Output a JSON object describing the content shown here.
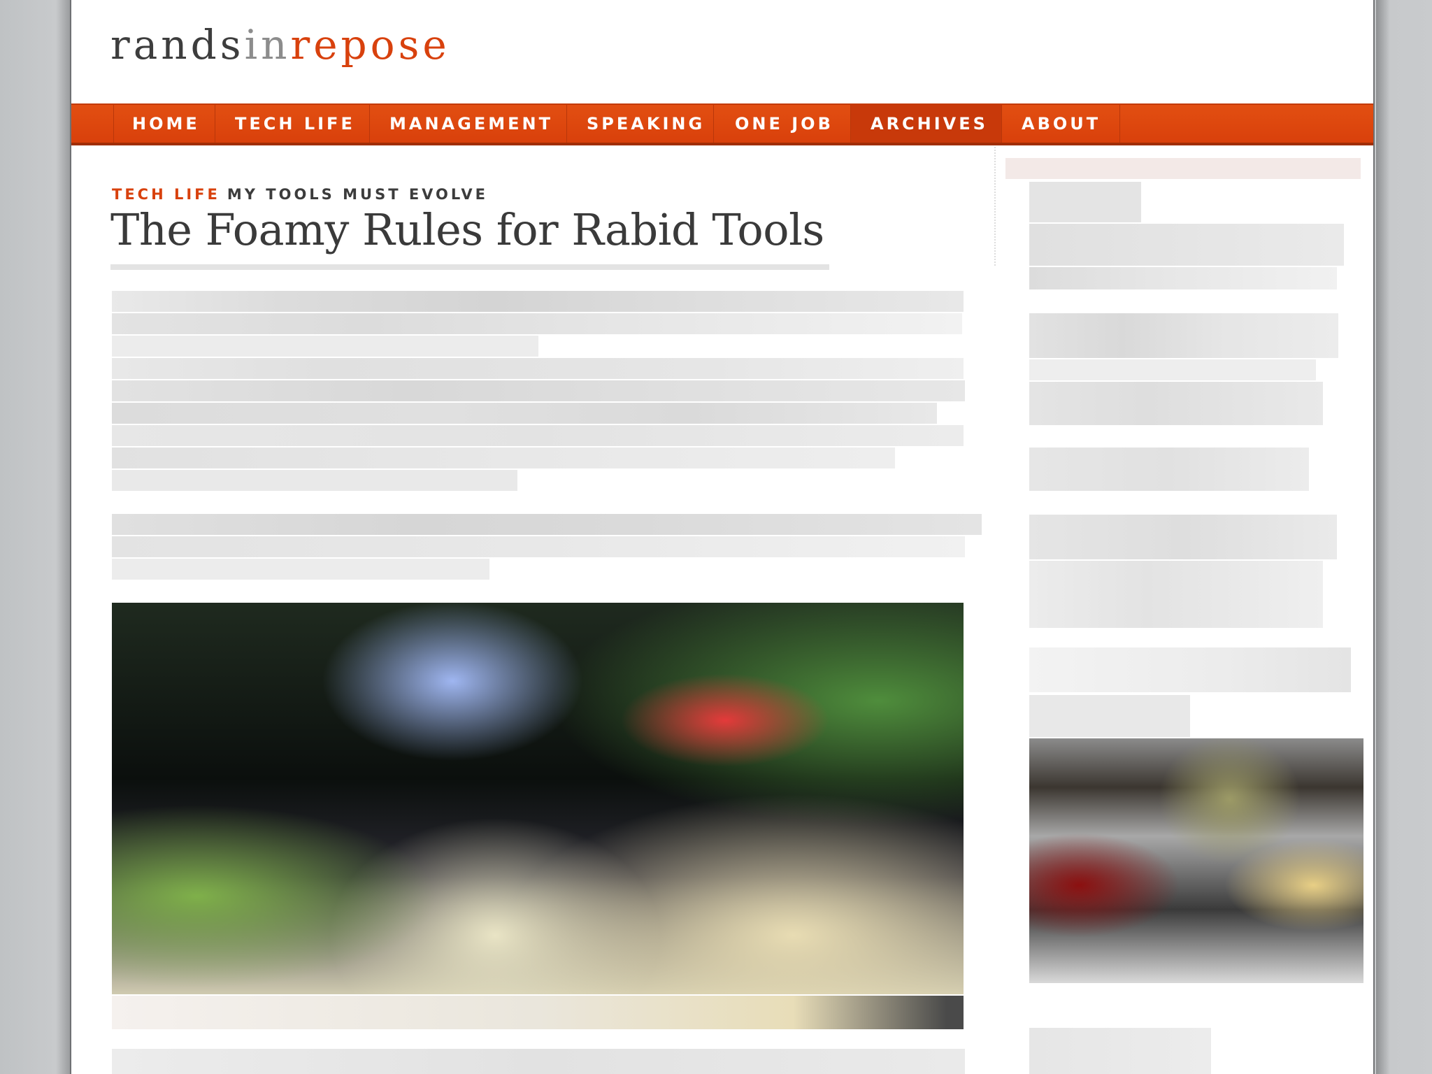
{
  "site": {
    "logo": {
      "part1": "rands",
      "part2": "in",
      "part3": "repose"
    }
  },
  "nav": {
    "items": [
      {
        "label": "HOME",
        "active": false
      },
      {
        "label": "TECH LIFE",
        "active": false
      },
      {
        "label": "MANAGEMENT",
        "active": false
      },
      {
        "label": "SPEAKING",
        "active": false
      },
      {
        "label": "ONE JOB",
        "active": false
      },
      {
        "label": "ARCHIVES",
        "active": true
      },
      {
        "label": "ABOUT",
        "active": false
      }
    ]
  },
  "article": {
    "category": "TECH LIFE",
    "subtitle": "MY TOOLS MUST EVOLVE",
    "title": "The Foamy Rules for Rabid Tools"
  },
  "colors": {
    "brand_orange": "#d8410d",
    "text_dark": "#3a3a3a",
    "logo_gray": "#8c8c8c"
  }
}
